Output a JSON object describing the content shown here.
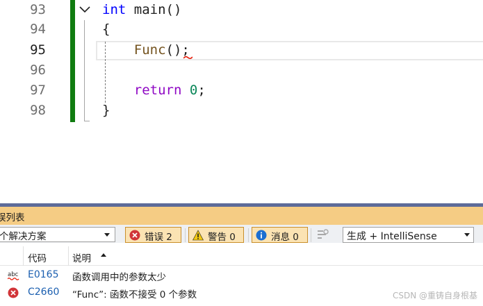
{
  "editor": {
    "lines": [
      {
        "number": "93",
        "parts": [
          {
            "t": "int",
            "c": "kw"
          },
          {
            "t": " main()",
            "c": "plain"
          }
        ]
      },
      {
        "number": "94",
        "parts": [
          {
            "t": "{",
            "c": "plain"
          }
        ]
      },
      {
        "number": "95",
        "parts": [
          {
            "t": "    ",
            "c": "plain"
          },
          {
            "t": "Func",
            "c": "fn"
          },
          {
            "t": "();",
            "c": "plain"
          }
        ]
      },
      {
        "number": "96",
        "parts": []
      },
      {
        "number": "97",
        "parts": [
          {
            "t": "    ",
            "c": "plain"
          },
          {
            "t": "return",
            "c": "kw-return"
          },
          {
            "t": " ",
            "c": "plain"
          },
          {
            "t": "0",
            "c": "num"
          },
          {
            "t": ";",
            "c": "plain"
          }
        ]
      },
      {
        "number": "98",
        "parts": [
          {
            "t": "}",
            "c": "plain"
          }
        ]
      }
    ],
    "current_line_number": "95",
    "colors": {
      "keyword": "#0000ff",
      "control_keyword": "#8f08c4",
      "function": "#74531f",
      "number": "#098658",
      "change_bar": "#107c10",
      "squiggle": "#e51400"
    }
  },
  "error_list": {
    "title": "误列表",
    "scope_value": "个解决方案",
    "filters": {
      "errors_label": "错误 2",
      "warnings_label": "警告 0",
      "messages_label": "消息 0"
    },
    "source_value": "生成 + IntelliSense",
    "columns": {
      "code": "代码",
      "description": "说明"
    },
    "rows": [
      {
        "type_icon": "intellisense-spell-icon",
        "code": "E0165",
        "description": "函数调用中的参数太少"
      },
      {
        "type_icon": "error-icon",
        "code": "C2660",
        "description": "“Func”: 函数不接受 0 个参数"
      }
    ],
    "colors": {
      "title_bar": "#f5cc84",
      "accent": "#5d6b99",
      "filter_button": "#fbe3b3",
      "code_link": "#1b5fb0",
      "error": "#d13438"
    }
  },
  "watermark": "CSDN @重铸自身根基"
}
